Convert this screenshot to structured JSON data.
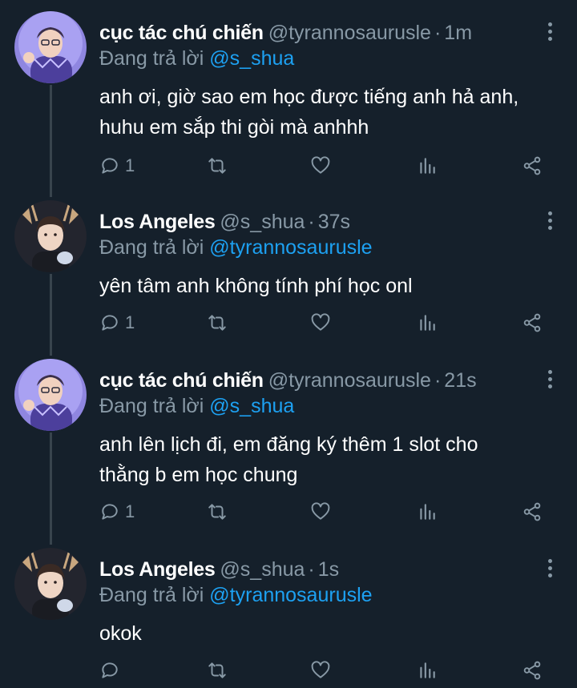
{
  "tweets": [
    {
      "name": "cục tác chú chiến",
      "handle": "@tyrannosaurusle",
      "time": "1m",
      "reply_prefix": "Đang trả lời",
      "reply_to": "@s_shua",
      "text_lines": [
        "anh ơi, giờ sao em học được tiếng anh hả anh,",
        "huhu em sắp thi gòi mà anhhh"
      ],
      "reply_count": "1",
      "avatar": "avatar-purple"
    },
    {
      "name": "Los Angeles",
      "handle": "@s_shua",
      "time": "37s",
      "reply_prefix": "Đang trả lời",
      "reply_to": "@tyrannosaurusle",
      "text_lines": [
        "yên tâm anh không tính phí học onl"
      ],
      "reply_count": "1",
      "avatar": "avatar-dark"
    },
    {
      "name": "cục tác chú chiến",
      "handle": "@tyrannosaurusle",
      "time": "21s",
      "reply_prefix": "Đang trả lời",
      "reply_to": "@s_shua",
      "text_lines": [
        "anh lên lịch đi, em đăng ký thêm 1 slot cho",
        "thằng b em học chung"
      ],
      "reply_count": "1",
      "avatar": "avatar-purple"
    },
    {
      "name": "Los Angeles",
      "handle": "@s_shua",
      "time": "1s",
      "reply_prefix": "Đang trả lời",
      "reply_to": "@tyrannosaurusle",
      "text_lines": [
        "okok"
      ],
      "reply_count": "",
      "avatar": "avatar-dark"
    }
  ],
  "separator": "·",
  "colors": {
    "background": "#15202b",
    "muted": "#8899a6",
    "mention": "#1da1f2",
    "thread_line": "#38444d"
  },
  "icons": [
    "reply-icon",
    "retweet-icon",
    "like-icon",
    "analytics-icon",
    "share-icon",
    "more-icon"
  ]
}
